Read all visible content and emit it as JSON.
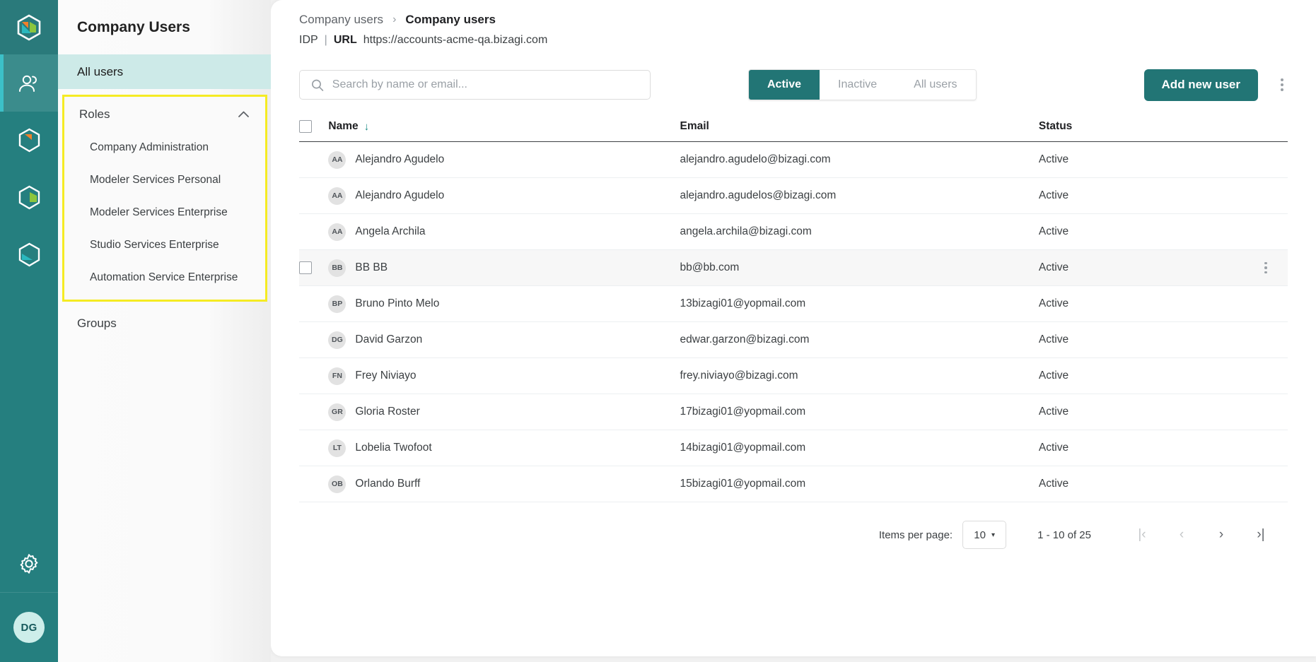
{
  "rail": {
    "logo_icon": "bizagi-hexagon-logo",
    "items": [
      {
        "icon": "users-group-icon",
        "name": "users",
        "active": true
      },
      {
        "icon": "hexagon-orange-icon",
        "name": "modeler",
        "active": false
      },
      {
        "icon": "hexagon-green-icon",
        "name": "studio",
        "active": false
      },
      {
        "icon": "hexagon-cyan-icon",
        "name": "automation",
        "active": false
      }
    ],
    "settings_icon": "gear-icon",
    "avatar_initials": "DG"
  },
  "sidebar": {
    "title": "Company Users",
    "all_users_label": "All users",
    "roles": {
      "label": "Roles",
      "expanded": true,
      "chevron_icon": "chevron-up-icon",
      "items": [
        "Company Administration",
        "Modeler Services Personal",
        "Modeler Services Enterprise",
        "Studio Services Enterprise",
        "Automation Service Enterprise"
      ]
    },
    "groups_label": "Groups",
    "highlight_color": "#f5eb23"
  },
  "header": {
    "breadcrumb_parent": "Company users",
    "breadcrumb_sep": "›",
    "breadcrumb_current": "Company users",
    "idp_label": "IDP",
    "divider": "|",
    "url_label": "URL",
    "url_value": "https://accounts-acme-qa.bizagi.com"
  },
  "toolbar": {
    "search_placeholder": "Search by name or email...",
    "search_value": "",
    "search_icon": "search-icon",
    "filters": [
      {
        "label": "Active",
        "selected": true
      },
      {
        "label": "Inactive",
        "selected": false
      },
      {
        "label": "All users",
        "selected": false
      }
    ],
    "add_user_label": "Add new user",
    "overflow_icon": "kebab-menu-icon",
    "accent_color": "#227575"
  },
  "table": {
    "columns": [
      "Name",
      "Email",
      "Status"
    ],
    "sort_column": "Name",
    "sort_icon": "arrow-down-icon",
    "rows": [
      {
        "initials": "AA",
        "name": "Alejandro Agudelo",
        "email": "alejandro.agudelo@bizagi.com",
        "status": "Active",
        "hover": false
      },
      {
        "initials": "AA",
        "name": "Alejandro Agudelo",
        "email": "alejandro.agudelos@bizagi.com",
        "status": "Active",
        "hover": false
      },
      {
        "initials": "AA",
        "name": "Angela Archila",
        "email": "angela.archila@bizagi.com",
        "status": "Active",
        "hover": false
      },
      {
        "initials": "BB",
        "name": "BB BB",
        "email": "bb@bb.com",
        "status": "Active",
        "hover": true
      },
      {
        "initials": "BP",
        "name": "Bruno Pinto Melo",
        "email": "13bizagi01@yopmail.com",
        "status": "Active",
        "hover": false
      },
      {
        "initials": "DG",
        "name": "David Garzon",
        "email": "edwar.garzon@bizagi.com",
        "status": "Active",
        "hover": false
      },
      {
        "initials": "FN",
        "name": "Frey Niviayo",
        "email": "frey.niviayo@bizagi.com",
        "status": "Active",
        "hover": false
      },
      {
        "initials": "GR",
        "name": "Gloria Roster",
        "email": "17bizagi01@yopmail.com",
        "status": "Active",
        "hover": false
      },
      {
        "initials": "LT",
        "name": "Lobelia Twofoot",
        "email": "14bizagi01@yopmail.com",
        "status": "Active",
        "hover": false
      },
      {
        "initials": "OB",
        "name": "Orlando Burff",
        "email": "15bizagi01@yopmail.com",
        "status": "Active",
        "hover": false
      }
    ]
  },
  "pagination": {
    "items_per_page_label": "Items per page:",
    "items_per_page_value": "10",
    "caret_icon": "caret-down-icon",
    "range_text": "1 - 10 of 25",
    "first_icon": "|‹",
    "prev_icon": "‹",
    "next_icon": "›",
    "last_icon": "›|",
    "first_enabled": false,
    "prev_enabled": false,
    "next_enabled": true,
    "last_enabled": true
  }
}
